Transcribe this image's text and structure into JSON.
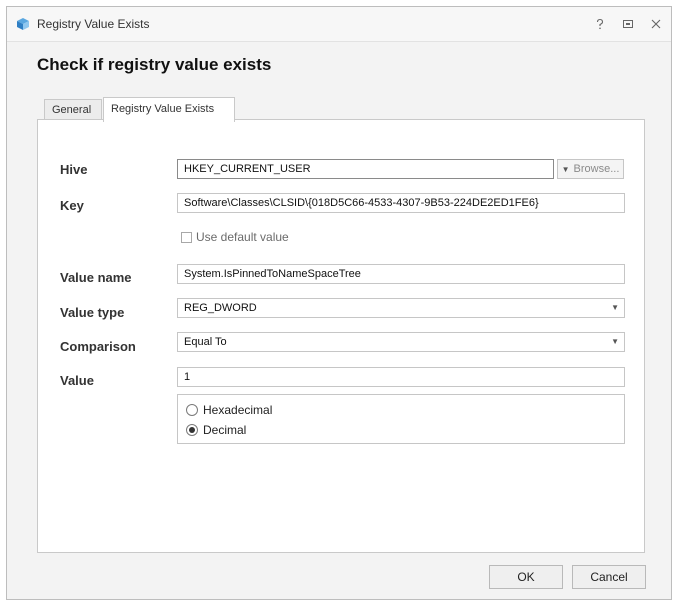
{
  "window": {
    "title": "Registry Value Exists"
  },
  "heading": "Check if registry value exists",
  "tabs": [
    {
      "label": "General"
    },
    {
      "label": "Registry Value Exists"
    }
  ],
  "form": {
    "hive": {
      "label": "Hive",
      "value": "HKEY_CURRENT_USER",
      "browse_label": "Browse..."
    },
    "key": {
      "label": "Key",
      "value": "Software\\Classes\\CLSID\\{018D5C66-4533-4307-9B53-224DE2ED1FE6}"
    },
    "use_default": {
      "label": "Use default value",
      "checked": false
    },
    "value_name": {
      "label": "Value name",
      "value": "System.IsPinnedToNameSpaceTree"
    },
    "value_type": {
      "label": "Value type",
      "value": "REG_DWORD"
    },
    "comparison": {
      "label": "Comparison",
      "value": "Equal To"
    },
    "value": {
      "label": "Value",
      "value": "1"
    },
    "format": {
      "options": [
        {
          "label": "Hexadecimal",
          "checked": false
        },
        {
          "label": "Decimal",
          "checked": true
        }
      ]
    }
  },
  "buttons": {
    "ok": "OK",
    "cancel": "Cancel"
  }
}
